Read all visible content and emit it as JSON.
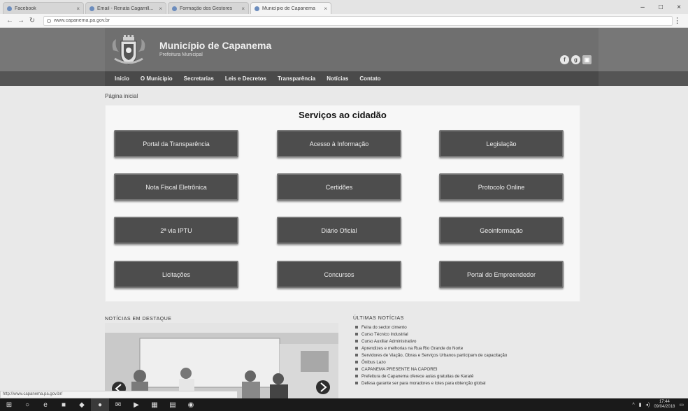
{
  "browser": {
    "tabs": [
      {
        "label": "Facebook",
        "active": false
      },
      {
        "label": "Email - Renata Cagarrill...",
        "active": false
      },
      {
        "label": "Formação dos Gestores",
        "active": false
      },
      {
        "label": "Município de Capanema",
        "active": true
      }
    ],
    "url": "www.capanema.pa.gov.br",
    "window_controls": {
      "minimize": "–",
      "maximize": "□",
      "close": "×"
    }
  },
  "site": {
    "title": "Município de Capanema",
    "subtitle": "Prefeitura Municipal",
    "nav": [
      "Início",
      "O Município",
      "Secretarias",
      "Leis e Decretos",
      "Transparência",
      "Notícias",
      "Contato"
    ],
    "breadcrumb": "Página inicial",
    "social": [
      "f",
      "g",
      "▣"
    ]
  },
  "services": {
    "title": "Serviços ao cidadão",
    "buttons": [
      "Portal da Transparência",
      "Acesso à Informação",
      "Legislação",
      "Nota Fiscal Eletrônica",
      "Certidões",
      "Protocolo Online",
      "2ª via IPTU",
      "Diário Oficial",
      "Geoinformação",
      "Licitações",
      "Concursos",
      "Portal do Empreendedor"
    ]
  },
  "news": {
    "featured_title": "NOTÍCIAS EM DESTAQUE",
    "latest_title": "ÚLTIMAS NOTÍCIAS",
    "latest": [
      "Feira do sector cimento",
      "Curso Técnico Industrial",
      "Curso Auxiliar Administrativo",
      "Aprendizes e melhorias na Rua Rio Grande do Norte",
      "Servidores de Viação, Obras e Serviços Urbanos participam de capacitação",
      "Ônibus Lazo",
      "CAPANEMA PRESENTE NA CAPOREI",
      "Prefeitura de Capanema oferece aulas gratuitas de Karatê",
      "Defesa garante ser para moradores e lotes para obtenção global"
    ]
  },
  "status_tip": "http://www.capanema.pa.gov.br/",
  "taskbar": {
    "icons": [
      "windows-icon",
      "search-icon",
      "edge-icon",
      "folder-icon",
      "store-icon",
      "chrome-icon",
      "mail-icon",
      "media-icon",
      "app-icon",
      "app2-icon",
      "app3-icon"
    ],
    "time": "17:44",
    "date": "09/04/2018"
  },
  "colors": {
    "header": "#6f6f6f",
    "nav": "#4a4a4a",
    "button": "#4d4d4d"
  }
}
